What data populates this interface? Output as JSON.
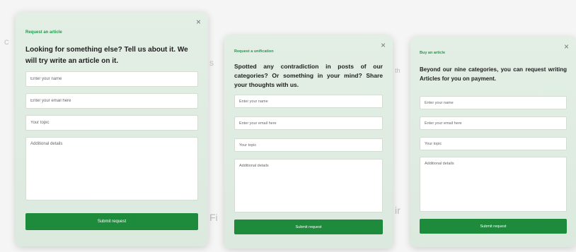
{
  "cards": [
    {
      "kicker": "Request an article",
      "heading": "Looking for something else? Tell us about it. We will try write an article on it.",
      "name_placeholder": "Enter your name",
      "email_placeholder": "Enter your email here",
      "topic_placeholder": "Your topic",
      "details_placeholder": "Additional details",
      "submit_label": "Submit request",
      "close_glyph": "×"
    },
    {
      "kicker": "Request a unification",
      "heading": "Spotted any contradiction in posts of our categories? Or something in your mind? Share your thoughts with us.",
      "name_placeholder": "Enter your name",
      "email_placeholder": "Enter your email here",
      "topic_placeholder": "Your topic",
      "details_placeholder": "Additional details",
      "submit_label": "Submit request",
      "close_glyph": "×"
    },
    {
      "kicker": "Buy an article",
      "heading": "Beyond our nine categories, you can request writing Articles for you on payment.",
      "name_placeholder": "Enter your name",
      "email_placeholder": "Enter your email here",
      "topic_placeholder": "Your topic",
      "details_placeholder": "Additional details",
      "submit_label": "Submit request",
      "close_glyph": "×"
    }
  ],
  "colors": {
    "accent": "#1f9a4c",
    "button": "#1e8a3b",
    "card_bg": "#e3efe5"
  }
}
